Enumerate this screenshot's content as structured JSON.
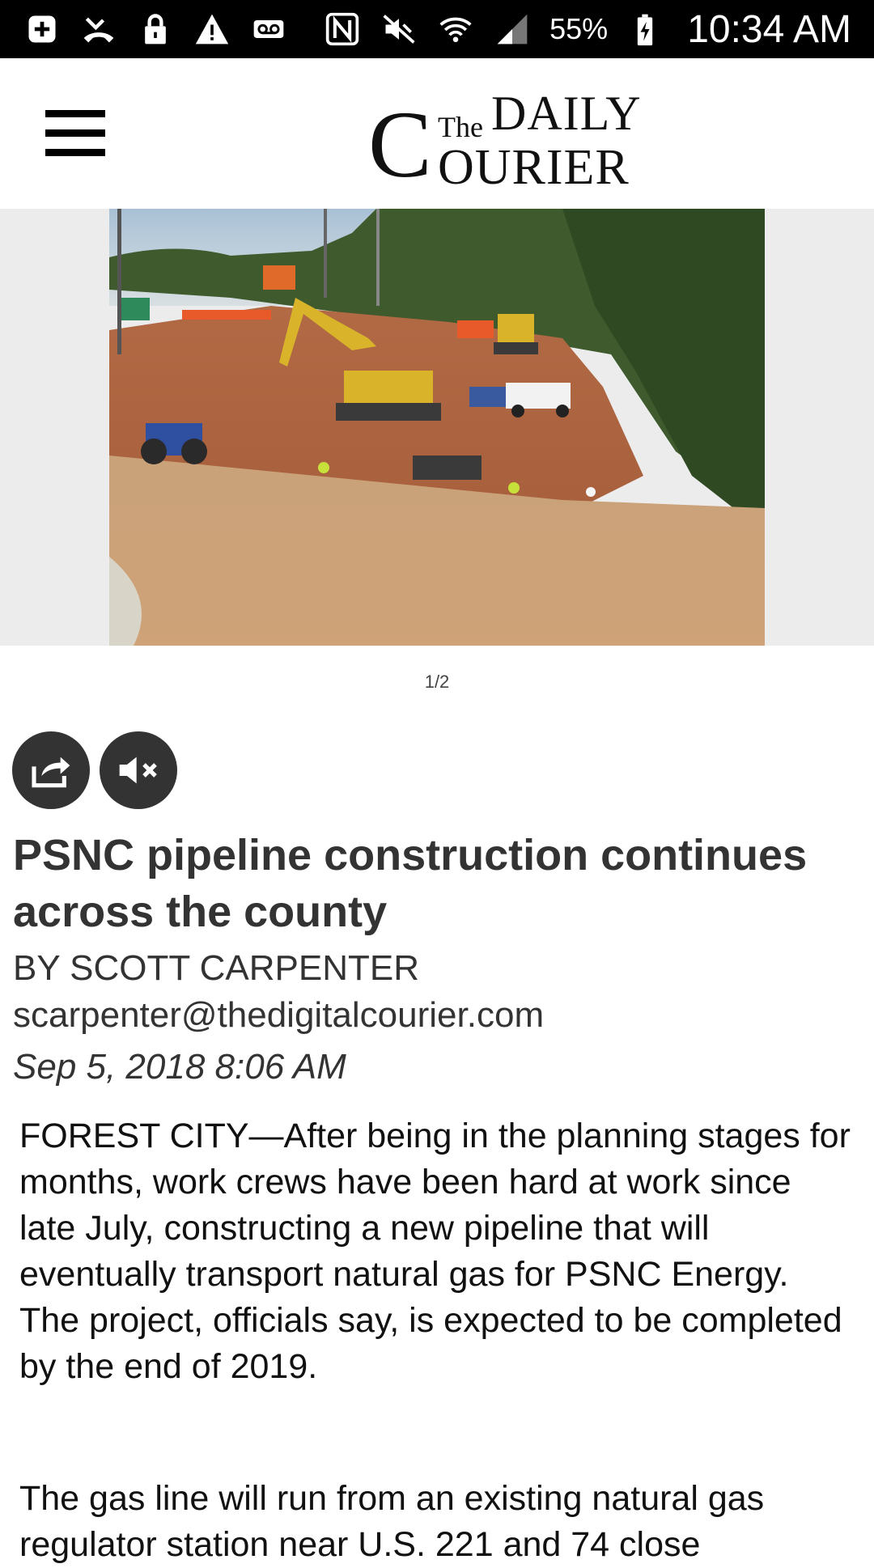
{
  "status_bar": {
    "left_icons": [
      "add-box-icon",
      "missed-call-icon",
      "lock-icon",
      "warning-icon",
      "voicemail-icon"
    ],
    "right_icons": [
      "nfc-icon",
      "mute-icon",
      "wifi-icon",
      "signal-icon",
      "battery-charging-icon"
    ],
    "battery": "55%",
    "time": "10:34 AM"
  },
  "header": {
    "logo": {
      "the": "The",
      "daily": "DAILY",
      "courier_c": "C",
      "courier_rest": "OURIER"
    }
  },
  "gallery": {
    "counter": "1/2"
  },
  "actions": [
    "share-icon",
    "mute-video-icon"
  ],
  "article": {
    "headline": "PSNC pipeline construction continues across the county",
    "byline": "BY SCOTT CARPENTER",
    "email": "scarpenter@thedigitalcourier.com",
    "date": "Sep 5, 2018 8:06 AM",
    "paragraphs": [
      "FOREST CITY—After being in the planning stages for months, work crews have been hard at work since late July, constructing a new pipeline that will eventually transport natural gas for PSNC Energy. The project, officials say, is expected to be completed by the end of 2019.",
      "The gas line will run from an existing natural gas regulator station near U.S. 221 and 74 close"
    ]
  },
  "colors": {
    "status_bar_bg": "#000000",
    "action_button_bg": "#333333",
    "photo_band_bg": "#ececec",
    "text": "#222222"
  }
}
